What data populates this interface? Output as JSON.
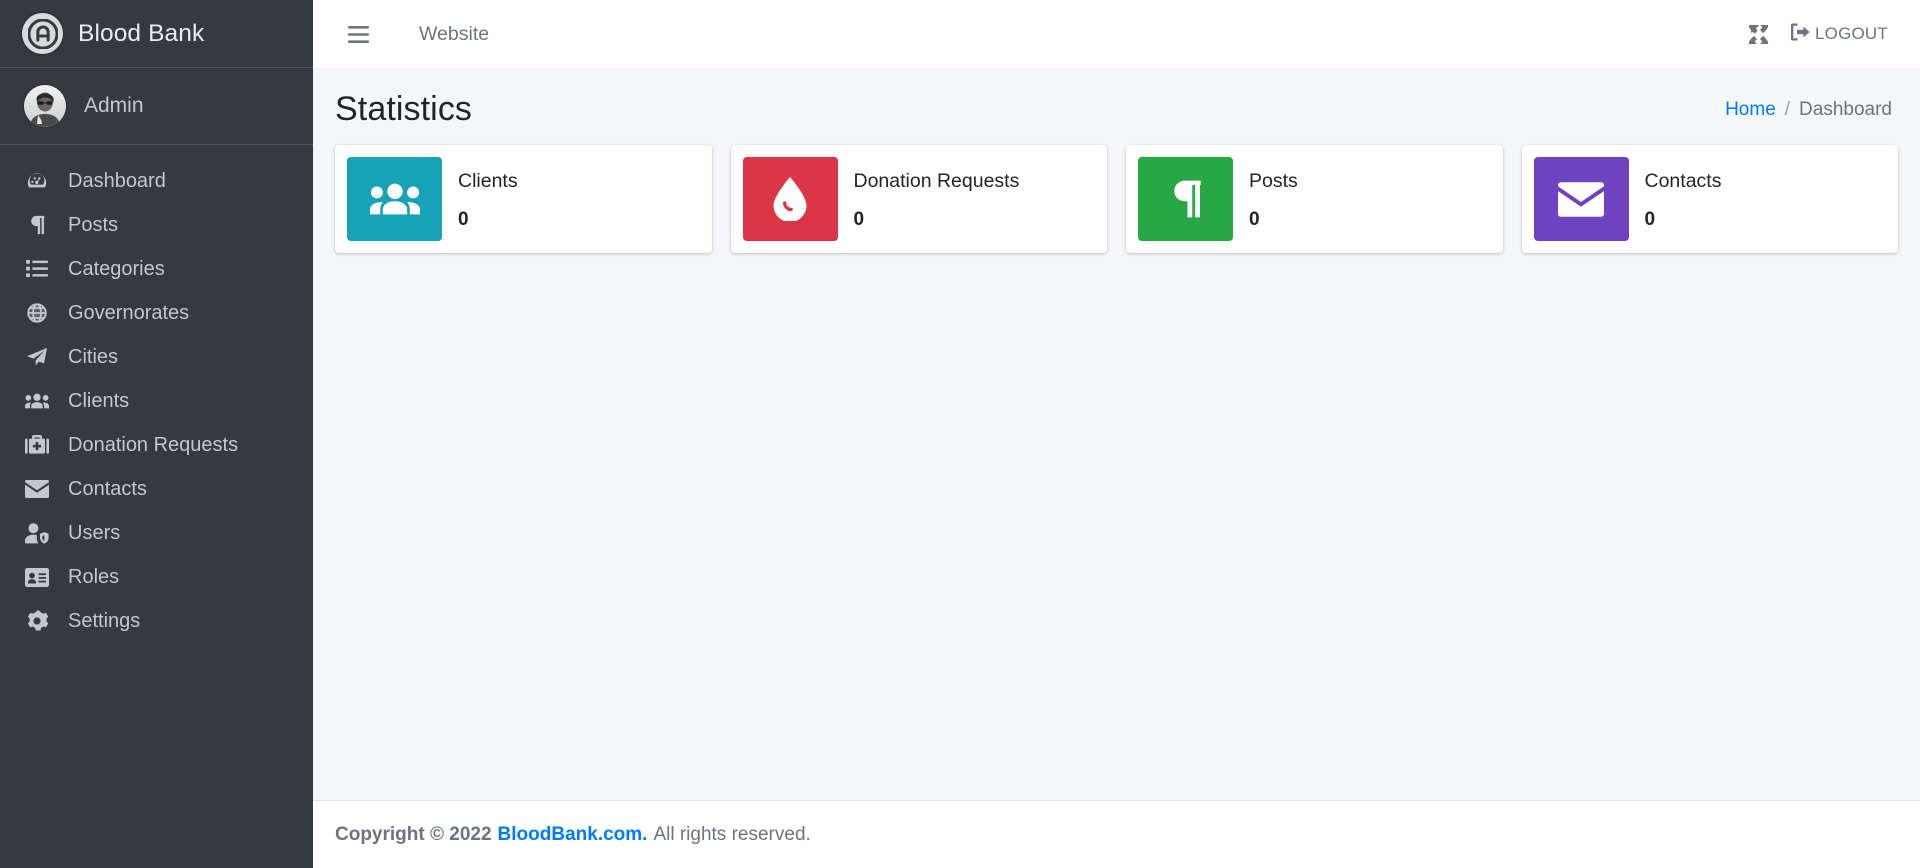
{
  "brand": {
    "title": "Blood Bank",
    "logo_icon": "bloodbank-logo-icon"
  },
  "user": {
    "name": "Admin",
    "avatar_icon": "user-avatar"
  },
  "sidebar": {
    "items": [
      {
        "label": "Dashboard",
        "icon": "tachometer-icon"
      },
      {
        "label": "Posts",
        "icon": "pilcrow-icon"
      },
      {
        "label": "Categories",
        "icon": "list-icon"
      },
      {
        "label": "Governorates",
        "icon": "globe-icon"
      },
      {
        "label": "Cities",
        "icon": "paper-plane-icon"
      },
      {
        "label": "Clients",
        "icon": "users-icon"
      },
      {
        "label": "Donation Requests",
        "icon": "briefcase-medical-icon"
      },
      {
        "label": "Contacts",
        "icon": "envelope-icon"
      },
      {
        "label": "Users",
        "icon": "user-shield-icon"
      },
      {
        "label": "Roles",
        "icon": "id-card-icon"
      },
      {
        "label": "Settings",
        "icon": "gear-icon"
      }
    ]
  },
  "navbar": {
    "menu_toggle_icon": "hamburger-icon",
    "website_link": "Website",
    "fullscreen_icon": "expand-arrows-icon",
    "logout_label": "LOGOUT",
    "logout_icon": "sign-out-icon"
  },
  "header": {
    "title": "Statistics",
    "breadcrumb": {
      "home": "Home",
      "separator": "/",
      "current": "Dashboard"
    }
  },
  "stats": {
    "cards": [
      {
        "label": "Clients",
        "value": "0",
        "color": "#17a2b8",
        "icon": "users-icon"
      },
      {
        "label": "Donation Requests",
        "value": "0",
        "color": "#dc3545",
        "icon": "blood-drop-icon"
      },
      {
        "label": "Posts",
        "value": "0",
        "color": "#28a745",
        "icon": "pilcrow-icon"
      },
      {
        "label": "Contacts",
        "value": "0",
        "color": "#6f42c1",
        "icon": "envelope-icon"
      }
    ]
  },
  "footer": {
    "copyright": "Copyright © 2022",
    "site": "BloodBank.com.",
    "rights": "All rights reserved."
  }
}
